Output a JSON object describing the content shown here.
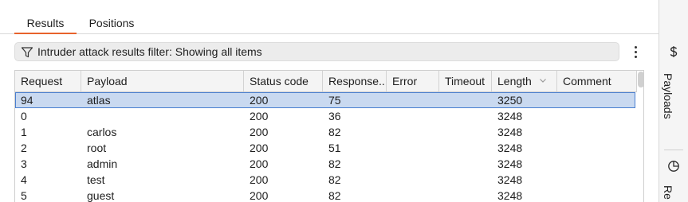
{
  "tabs": [
    {
      "label": "Results",
      "active": true
    },
    {
      "label": "Positions",
      "active": false
    }
  ],
  "filter": {
    "text": "Intruder attack results filter: Showing all items",
    "icon": "filter-icon"
  },
  "more_menu": {
    "icon": "kebab-menu-icon"
  },
  "table": {
    "columns": [
      {
        "label": "Request"
      },
      {
        "label": "Payload"
      },
      {
        "label": "Status code"
      },
      {
        "label": "Response..."
      },
      {
        "label": "Error"
      },
      {
        "label": "Timeout"
      },
      {
        "label": "Length",
        "sorted": "descending"
      },
      {
        "label": "Comment"
      }
    ],
    "rows": [
      {
        "request": "94",
        "payload": "atlas",
        "status": "200",
        "response": "75",
        "error": "",
        "timeout": "",
        "length": "3250",
        "comment": "",
        "selected": true
      },
      {
        "request": "0",
        "payload": "",
        "status": "200",
        "response": "36",
        "error": "",
        "timeout": "",
        "length": "3248",
        "comment": ""
      },
      {
        "request": "1",
        "payload": "carlos",
        "status": "200",
        "response": "82",
        "error": "",
        "timeout": "",
        "length": "3248",
        "comment": ""
      },
      {
        "request": "2",
        "payload": "root",
        "status": "200",
        "response": "51",
        "error": "",
        "timeout": "",
        "length": "3248",
        "comment": ""
      },
      {
        "request": "3",
        "payload": "admin",
        "status": "200",
        "response": "82",
        "error": "",
        "timeout": "",
        "length": "3248",
        "comment": ""
      },
      {
        "request": "4",
        "payload": "test",
        "status": "200",
        "response": "82",
        "error": "",
        "timeout": "",
        "length": "3248",
        "comment": ""
      },
      {
        "request": "5",
        "payload": "guest",
        "status": "200",
        "response": "82",
        "error": "",
        "timeout": "",
        "length": "3248",
        "comment": ""
      }
    ]
  },
  "side_panel": {
    "tabs": [
      {
        "label": "Payloads",
        "icon": "dollar-sign-icon"
      },
      {
        "label": "Re",
        "icon": "pie-chart-icon"
      }
    ]
  },
  "colors": {
    "accent": "#e8622c",
    "selected_row": "#c9d9f0",
    "selected_outline": "#4a7fd0",
    "header_bg": "#f4f4f4",
    "filter_bg": "#ececec"
  }
}
